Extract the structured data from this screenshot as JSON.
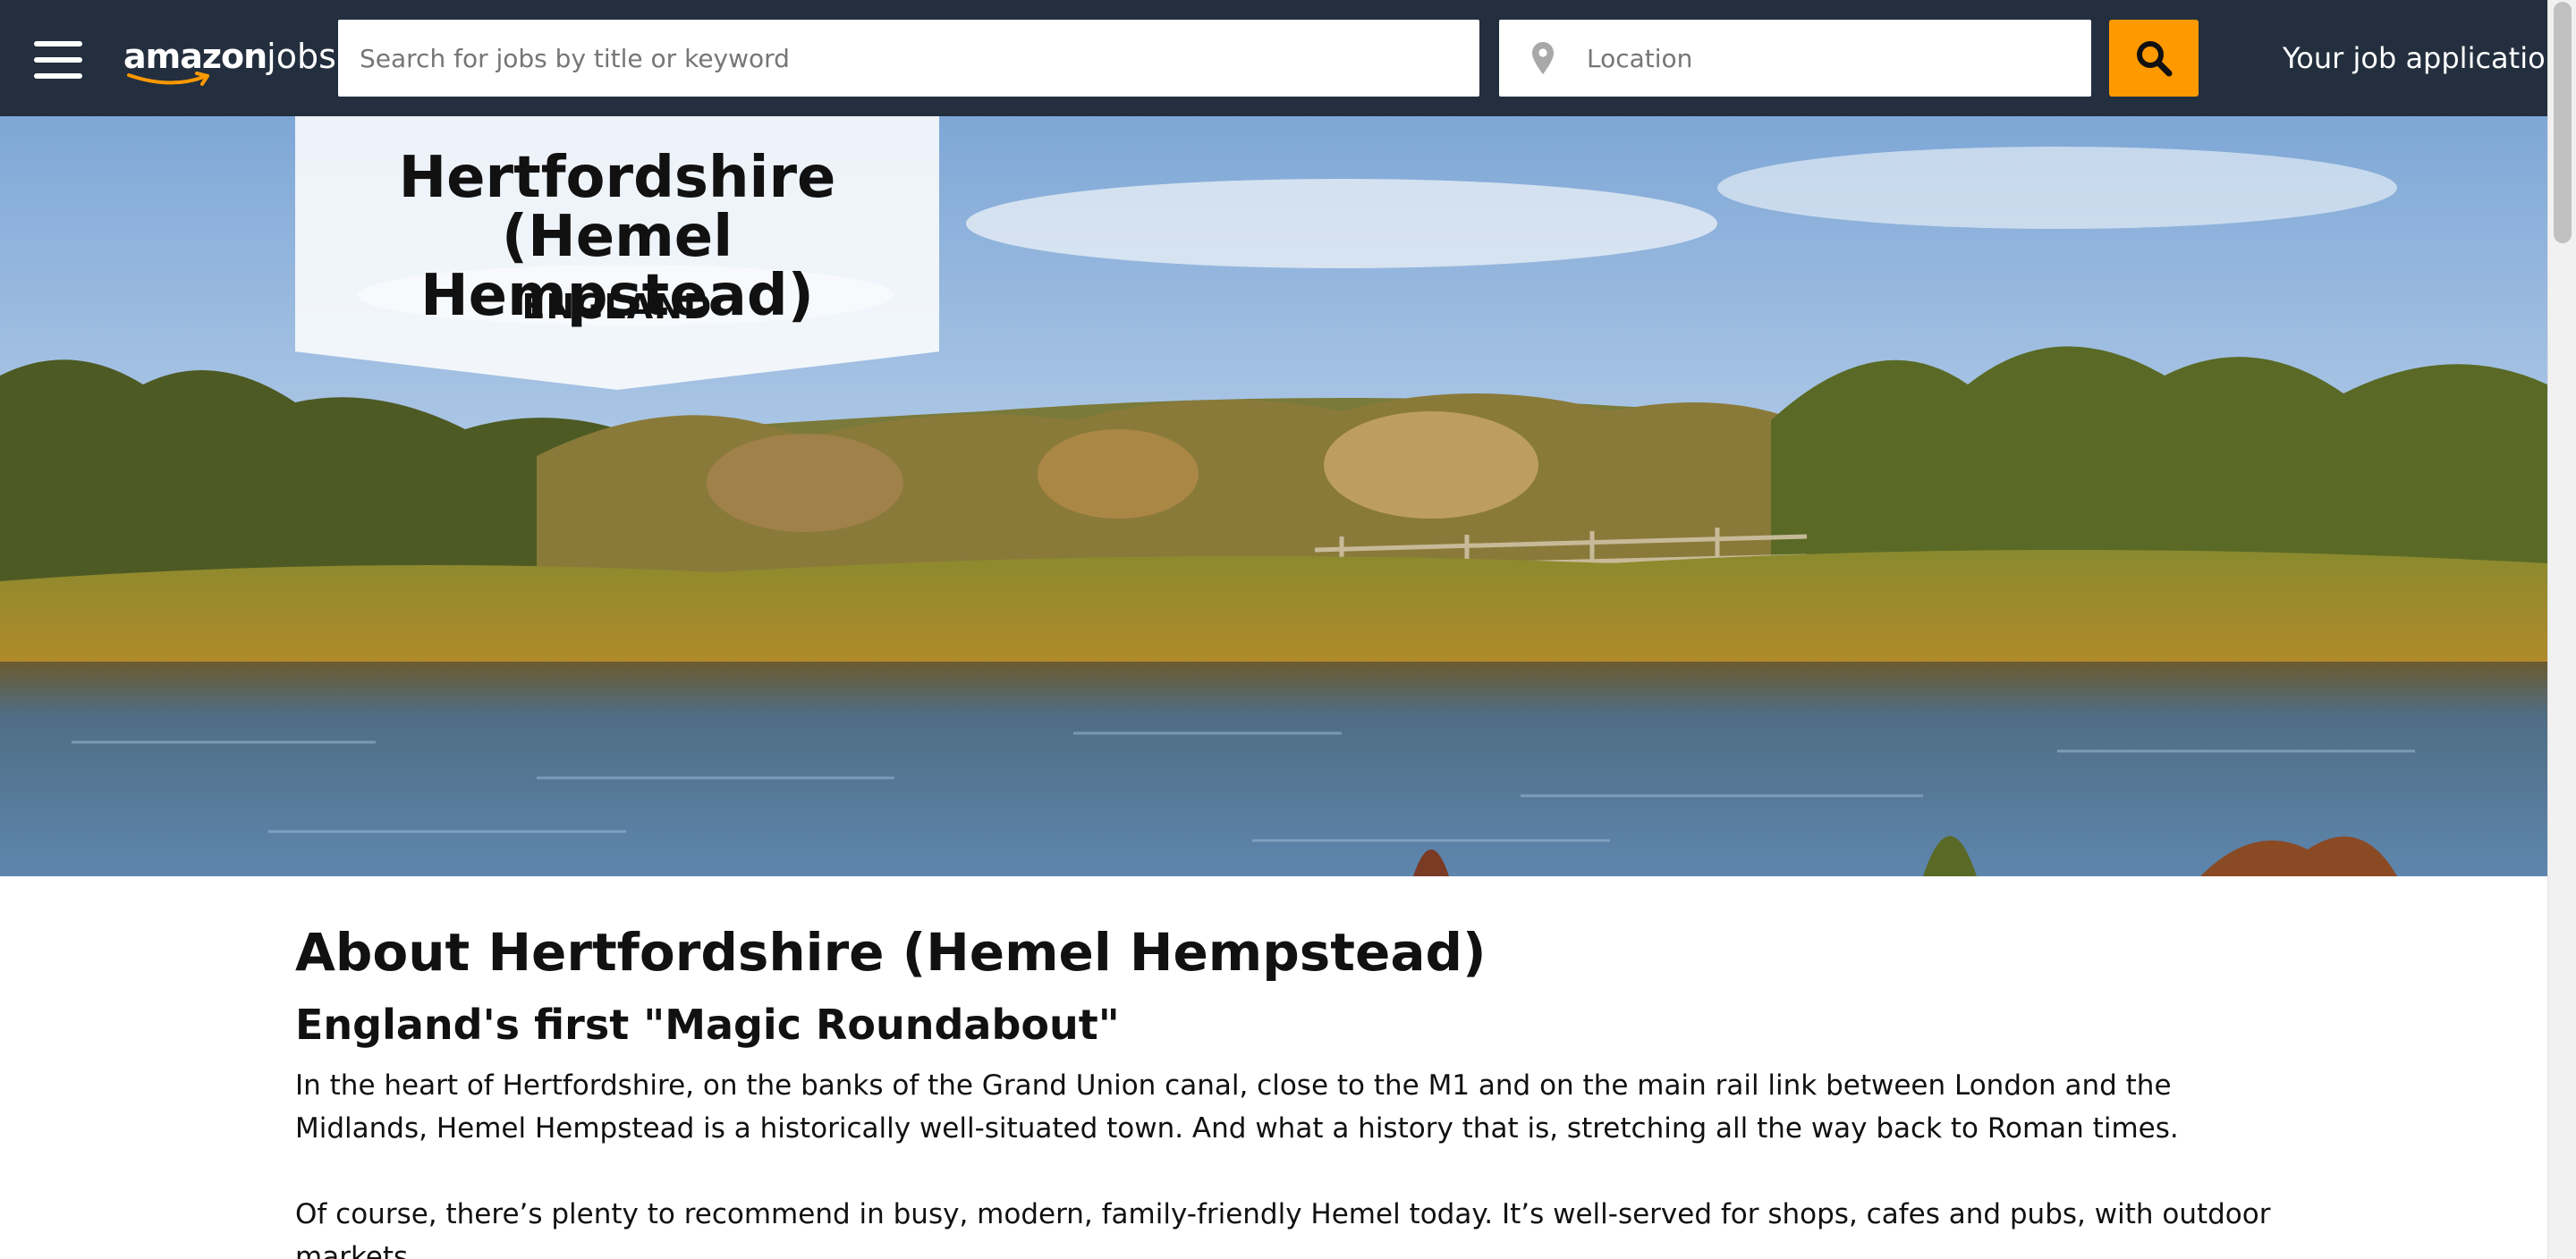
{
  "header": {
    "logo": {
      "amazon": "amazon",
      "jobs": "jobs"
    },
    "search_placeholder": "Search for jobs by title or keyword",
    "location_placeholder": "Location",
    "applications_link": "Your job application"
  },
  "hero": {
    "title": "Hertfordshire (Hemel Hempstead)",
    "subtitle": "ENGLAND"
  },
  "about": {
    "title": "About Hertfordshire (Hemel Hempstead)",
    "subtitle": "England's first \"Magic Roundabout\"",
    "paragraphs": [
      "In the heart of Hertfordshire, on the banks of the Grand Union canal, close to the M1 and on the main rail link between London and the Midlands, Hemel Hempstead is a historically well-situated town. And what a history that is, stretching all the way back to Roman times.",
      "Of course, there’s plenty to recommend in busy, modern, family-friendly Hemel today. It’s well-served for shops, cafes and pubs, with outdoor markets"
    ]
  },
  "colors": {
    "header_bg": "#232f3e",
    "accent": "#ff9900"
  },
  "icons": {
    "menu": "hamburger-menu-icon",
    "location": "location-pin-icon",
    "search": "search-icon"
  }
}
